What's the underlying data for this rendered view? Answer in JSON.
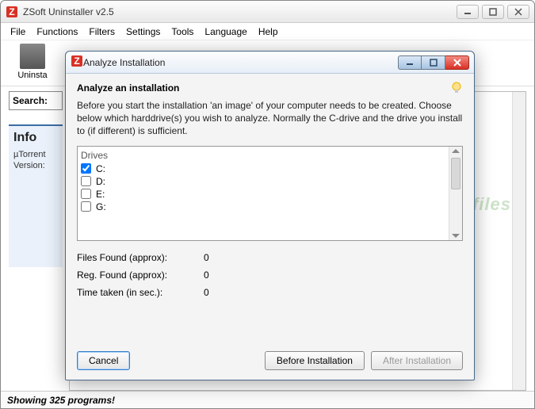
{
  "app": {
    "title": "ZSoft Uninstaller v2.5"
  },
  "menu": [
    "File",
    "Functions",
    "Filters",
    "Settings",
    "Tools",
    "Language",
    "Help"
  ],
  "toolbar": {
    "uninstall_label": "Uninsta"
  },
  "search": {
    "label": "Search:"
  },
  "info": {
    "title": "Info",
    "line1": "µTorrent",
    "line2": "Version:"
  },
  "statusbar": "Showing 325 programs!",
  "dialog": {
    "title": "Analyze Installation",
    "heading": "Analyze an installation",
    "description": "Before you start the installation 'an image' of your computer needs to be created. Choose below which harddrive(s) you wish to analyze. Normally the C-drive and the drive you install to (if different) is sufficient.",
    "drives": {
      "header": "Drives",
      "items": [
        {
          "label": "C:",
          "checked": true
        },
        {
          "label": "D:",
          "checked": false
        },
        {
          "label": "E:",
          "checked": false
        },
        {
          "label": "G:",
          "checked": false
        }
      ]
    },
    "stats": {
      "files_label": "Files Found (approx):",
      "files_value": "0",
      "reg_label": "Reg. Found (approx):",
      "reg_value": "0",
      "time_label": "Time taken (in sec.):",
      "time_value": "0"
    },
    "buttons": {
      "cancel": "Cancel",
      "before": "Before Installation",
      "after": "After Installation"
    }
  },
  "watermark": "Snapfiles"
}
